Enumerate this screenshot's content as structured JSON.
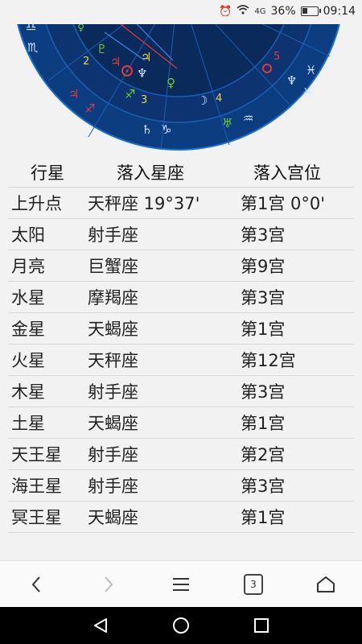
{
  "status_bar": {
    "signal_text": "4G",
    "battery_percent": "36%",
    "battery_level": 0.36,
    "time": "09:14"
  },
  "chart": {
    "house_numbers": [
      "2",
      "3",
      "4",
      "5"
    ],
    "colors": {
      "outer": "#0c3d80",
      "inner": "#0b2a5c",
      "ring": "#1a5fb4",
      "red": "#e53935",
      "green": "#6ccf2e",
      "yellow": "#e7d44a"
    }
  },
  "table": {
    "headers": [
      "行星",
      "落入星座",
      "落入宫位"
    ],
    "rows": [
      [
        "上升点",
        "天秤座 19°37'",
        "第1宫 0°0'"
      ],
      [
        "太阳",
        "射手座",
        "第3宫"
      ],
      [
        "月亮",
        "巨蟹座",
        "第9宫"
      ],
      [
        "水星",
        "摩羯座",
        "第3宫"
      ],
      [
        "金星",
        "天蝎座",
        "第1宫"
      ],
      [
        "火星",
        "天秤座",
        "第12宫"
      ],
      [
        "木星",
        "射手座",
        "第3宫"
      ],
      [
        "土星",
        "天蝎座",
        "第1宫"
      ],
      [
        "天王星",
        "射手座",
        "第2宫"
      ],
      [
        "海王星",
        "射手座",
        "第3宫"
      ],
      [
        "冥王星",
        "天蝎座",
        "第1宫"
      ]
    ]
  },
  "toolbar": {
    "tabs_count": "3"
  }
}
